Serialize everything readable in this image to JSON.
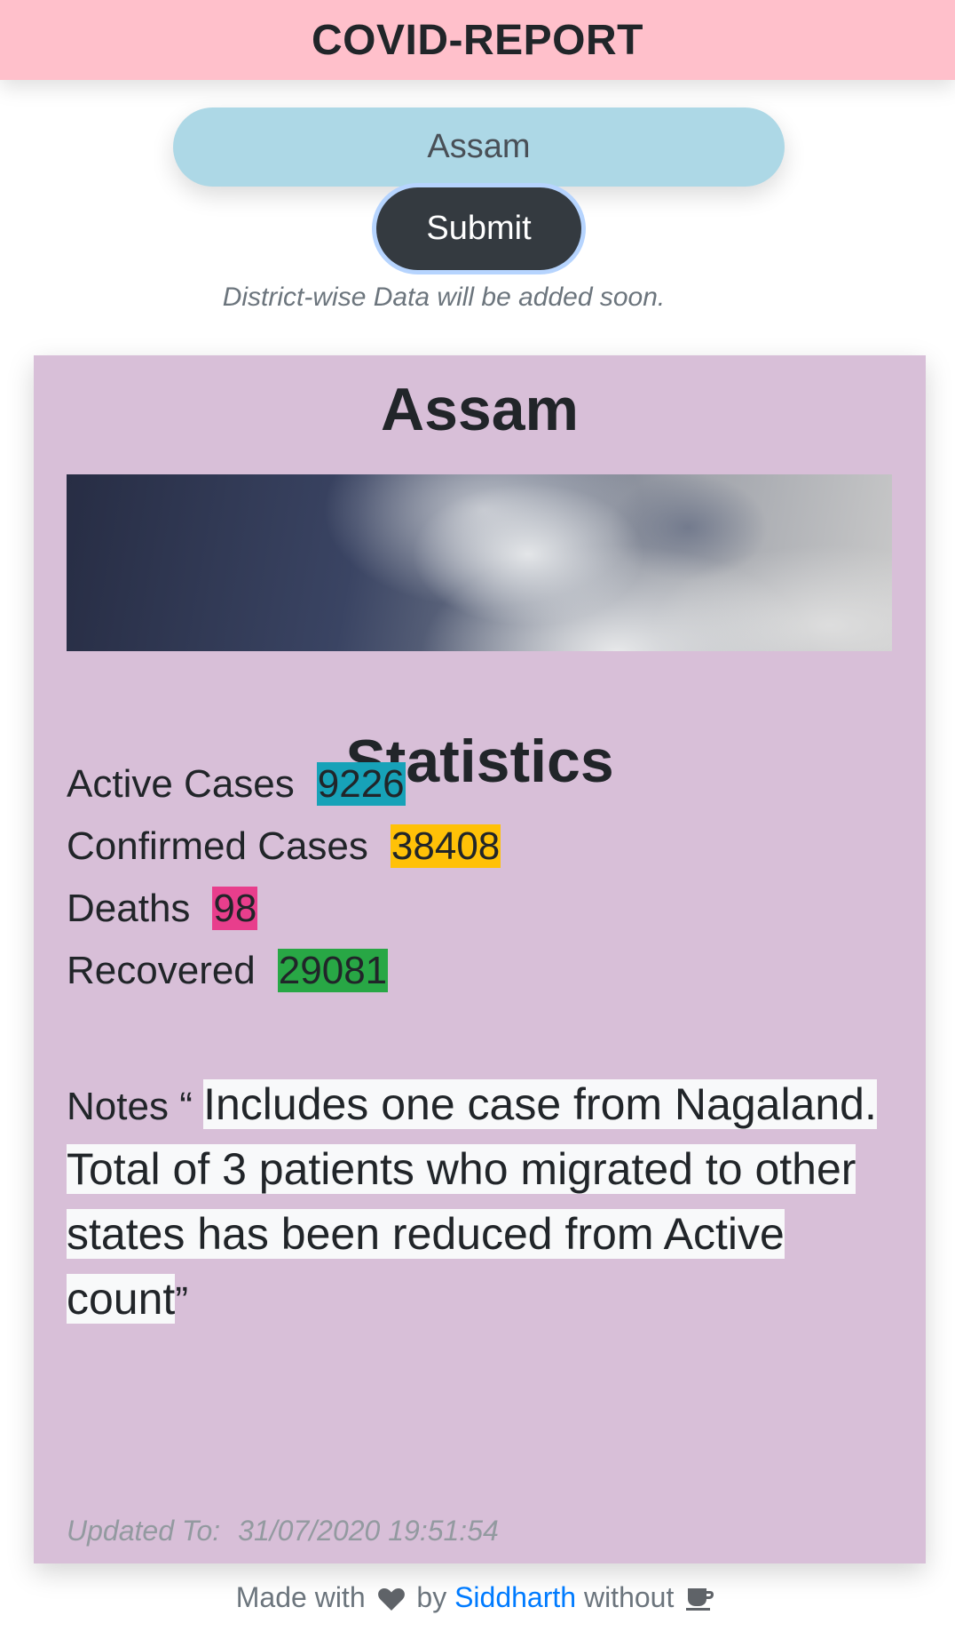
{
  "header": {
    "title": "COVID-REPORT"
  },
  "search": {
    "value": "Assam"
  },
  "submit": {
    "label": "Submit"
  },
  "note": "District-wise Data will be added soon.",
  "card": {
    "state": "Assam",
    "banner_icon": "cloudy-sky-image",
    "stats_heading": "Statistics",
    "stats": {
      "active": {
        "label": "Active Cases",
        "value": "9226",
        "color": "#17a2b8"
      },
      "confirmed": {
        "label": "Confirmed Cases",
        "value": "38408",
        "color": "#ffc107"
      },
      "deaths": {
        "label": "Deaths",
        "value": "98",
        "color": "#e83e8c"
      },
      "recovered": {
        "label": "Recovered",
        "value": "29081",
        "color": "#28a745"
      }
    },
    "notes": {
      "label": "Notes",
      "open_quote": "“",
      "text": "Includes one case from Nagaland. Total of 3 patients who migrated to other states has been reduced from Active count",
      "close_quote": "”"
    },
    "updated": {
      "label": "Updated To:",
      "value": "31/07/2020 19:51:54"
    }
  },
  "footer": {
    "made_with": "Made with",
    "heart_icon": "heart-icon",
    "by": "by",
    "author": "Siddharth",
    "without": "without",
    "coffee_icon": "coffee-icon"
  }
}
